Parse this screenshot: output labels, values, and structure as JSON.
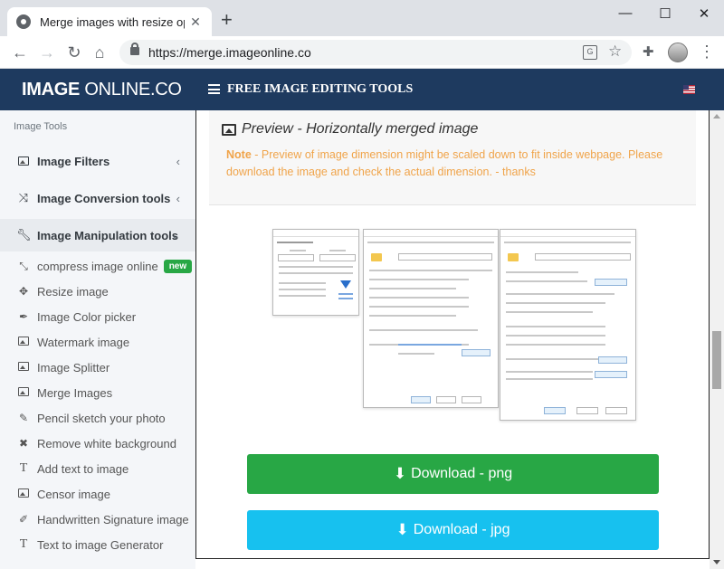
{
  "browser": {
    "tab_title": "Merge images with resize optic",
    "tab_close": "✕",
    "new_tab": "+",
    "window_controls": {
      "minimize": "—",
      "maximize": "☐",
      "close": "✕"
    },
    "url": "https://merge.imageonline.co",
    "icons": [
      "back-icon",
      "forward-icon",
      "reload-icon",
      "home-icon",
      "lock-icon",
      "translate-icon",
      "star-icon",
      "extensions-icon",
      "profile-avatar",
      "menu-icon"
    ]
  },
  "site_header": {
    "logo_bold": "IMAGE",
    "logo_rest": " ONLINE.CO",
    "nav_title": "FREE IMAGE EDITING TOOLS",
    "background_color": "#1e3a5f"
  },
  "sidebar": {
    "heading": "Image Tools",
    "groups": [
      {
        "label": "Image Filters",
        "icon": "image-icon",
        "chevron": "‹"
      },
      {
        "label": "Image Conversion tools",
        "icon": "shuffle-icon",
        "chevron": "‹"
      },
      {
        "label": "Image Manipulation tools",
        "icon": "wrench-icon",
        "chevron": "⌄"
      }
    ],
    "items": [
      {
        "label": "compress image online",
        "icon": "compress-icon",
        "badge": "new"
      },
      {
        "label": "Resize image",
        "icon": "move-icon"
      },
      {
        "label": "Image Color picker",
        "icon": "eyedropper-icon"
      },
      {
        "label": "Watermark image",
        "icon": "image-icon"
      },
      {
        "label": "Image Splitter",
        "icon": "image-icon"
      },
      {
        "label": "Merge Images",
        "icon": "image-icon"
      },
      {
        "label": "Pencil sketch your photo",
        "icon": "edit-icon"
      },
      {
        "label": "Remove white background",
        "icon": "times-icon"
      },
      {
        "label": "Add text to image",
        "icon": "text-icon"
      },
      {
        "label": "Censor image",
        "icon": "image-icon"
      },
      {
        "label": "Handwritten Signature image",
        "icon": "pen-icon"
      },
      {
        "label": "Text to image Generator",
        "icon": "text-icon"
      }
    ],
    "badge_color": "#28a745"
  },
  "main": {
    "preview_title": "Preview - Horizontally merged image",
    "note_label": "Note",
    "note_text": " - Preview of image dimension might be scaled down to fit inside webpage. Please download the image and check the actual dimension. - thanks",
    "note_color": "#f0a44a",
    "buttons": {
      "download_png": "Download - png",
      "download_jpg": "Download - jpg"
    },
    "button_colors": {
      "png": "#28a745",
      "jpg": "#17c1ef"
    }
  }
}
